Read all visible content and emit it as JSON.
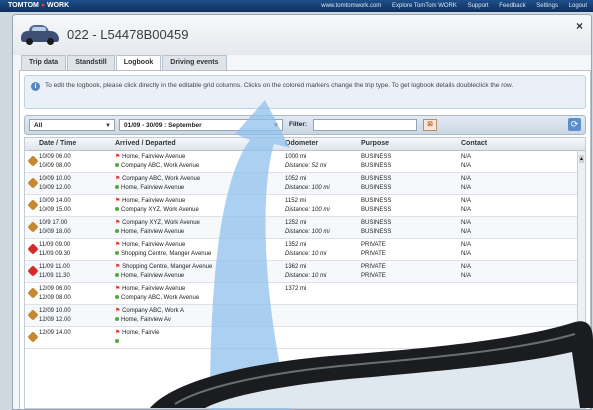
{
  "topbar": {
    "brand_main": "TOMTOM",
    "brand_sub": "WORK",
    "links": [
      "www.tomtomwork.com",
      "Explore TomTom WORK",
      "Support",
      "Feedback",
      "Settings",
      "Logout"
    ]
  },
  "window": {
    "title": "022 - L54478B00459",
    "close_glyph": "×"
  },
  "tabs": [
    {
      "label": "Trip data",
      "active": false
    },
    {
      "label": "Standstill",
      "active": false
    },
    {
      "label": "Logbook",
      "active": true
    },
    {
      "label": "Driving events",
      "active": false
    }
  ],
  "info": {
    "text": "To edit the logbook, please click directly in the editable grid columns. Clicks on the colored markers change the trip type. To get logbook details doubleclick the row."
  },
  "toolbar": {
    "type_select": "All",
    "period_select": "01/09 - 30/09 : September",
    "filter_label": "Filter:",
    "filter_value": ""
  },
  "grid": {
    "headers": [
      "Date / Time",
      "Arrived / Departed",
      "Odometer",
      "Purpose",
      "Contact"
    ],
    "rows": [
      {
        "type": "business",
        "t1": "10/09 06.00",
        "t2": "10/09 08.00",
        "a1": "Home, Fairview Avenue",
        "a2": "Company ABC, Work Avenue",
        "o1": "1000 mi",
        "o2": "Distance: 52 mi",
        "p1": "BUSINESS",
        "p2": "BUSINESS",
        "c1": "N/A",
        "c2": "N/A"
      },
      {
        "type": "business",
        "t1": "10/09 10.00",
        "t2": "10/09 12.00",
        "a1": "Company ABC, Work Avenue",
        "a2": "Home, Fairview Avenue",
        "o1": "1052 mi",
        "o2": "Distance: 100 mi",
        "p1": "BUSINESS",
        "p2": "BUSINESS",
        "c1": "N/A",
        "c2": "N/A"
      },
      {
        "type": "business",
        "t1": "10/09 14.00",
        "t2": "10/09 15.00",
        "a1": "Home, Fairview Avenue",
        "a2": "Company XYZ, Work Avenue",
        "o1": "1152 mi",
        "o2": "Distance: 100 mi",
        "p1": "BUSINESS",
        "p2": "BUSINESS",
        "c1": "N/A",
        "c2": "N/A"
      },
      {
        "type": "business",
        "t1": "10/9 17.00",
        "t2": "10/09 18.00",
        "a1": "Company XYZ, Work Avenue",
        "a2": "Home, Fairview Avenue",
        "o1": "1252 mi",
        "o2": "Distance: 100 mi",
        "p1": "BUSINESS",
        "p2": "BUSINESS",
        "c1": "N/A",
        "c2": "N/A"
      },
      {
        "type": "private",
        "t1": "11/09 09.00",
        "t2": "11/09 09.30",
        "a1": "Home, Fairview Avenue",
        "a2": "Shopping Centre, Manger Avenue",
        "o1": "1352 mi",
        "o2": "Distance: 10 mi",
        "p1": "PRIVATE",
        "p2": "PRIVATE",
        "c1": "N/A",
        "c2": "N/A"
      },
      {
        "type": "private",
        "t1": "11/09 11.00",
        "t2": "11/09 11.30",
        "a1": "Shopping Centre, Manger Avenue",
        "a2": "Home, Fairview Avenue",
        "o1": "1362 mi",
        "o2": "Distance: 10 mi",
        "p1": "PRIVATE",
        "p2": "PRIVATE",
        "c1": "N/A",
        "c2": "N/A"
      },
      {
        "type": "business",
        "t1": "12/09 06.00",
        "t2": "12/09 08.00",
        "a1": "Home, Fairview Avenue",
        "a2": "Company ABC, Work Avenue",
        "o1": "1372 mi",
        "o2": "",
        "p1": "",
        "p2": "",
        "c1": "",
        "c2": ""
      },
      {
        "type": "business",
        "t1": "12/09 10.00",
        "t2": "12/09 12.00",
        "a1": "Company ABC, Work A",
        "a2": "Home, Fairview Av",
        "o1": "",
        "o2": "",
        "p1": "",
        "p2": "",
        "c1": "",
        "c2": ""
      },
      {
        "type": "business",
        "t1": "12/09 14.00",
        "t2": "",
        "a1": "Home, Fairvie",
        "a2": "",
        "o1": "",
        "o2": "",
        "p1": "",
        "p2": "",
        "c1": "",
        "c2": ""
      }
    ]
  },
  "colors": {
    "accent": "#1e4f8a",
    "arrow": "#8fc0ec",
    "business_marker": "#c5892f",
    "private_marker": "#d92a2a"
  }
}
